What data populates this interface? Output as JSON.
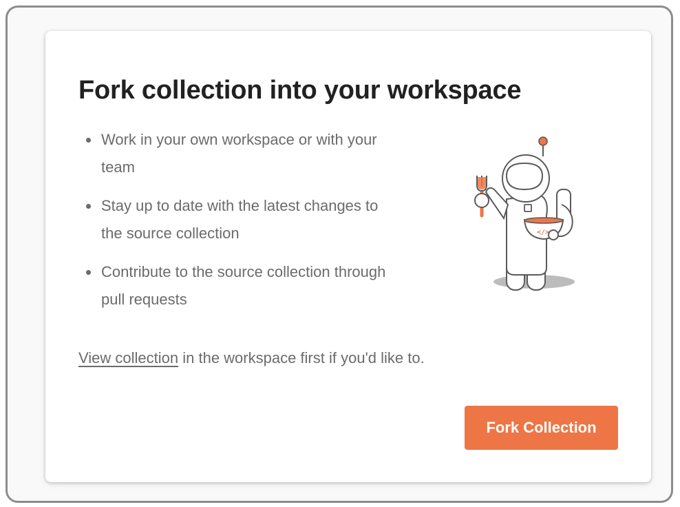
{
  "dialog": {
    "title": "Fork collection into your workspace",
    "bullets": [
      "Work in your own workspace or with your team",
      "Stay up to date with the latest changes to the source collection",
      "Contribute to the source collection through pull requests"
    ],
    "footnote": {
      "link_text": "View collection",
      "rest_text": " in the workspace first if you'd like to."
    },
    "fork_button_label": "Fork Collection",
    "illustration": {
      "name": "astronaut-with-fork-and-bowl-icon",
      "badge_text": "</>"
    }
  },
  "colors": {
    "accent": "#ee7646",
    "title_text": "#212121",
    "body_text": "#6b6b6b",
    "frame_border": "#8c8c8c"
  }
}
